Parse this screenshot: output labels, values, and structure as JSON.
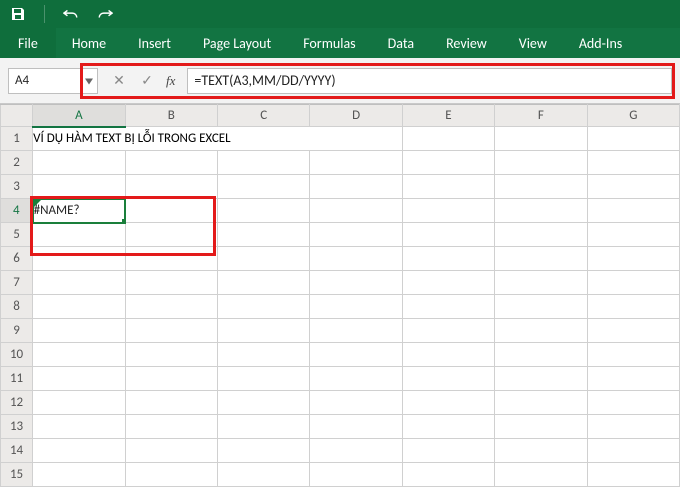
{
  "qat": {
    "save_icon": "save",
    "undo_icon": "undo",
    "redo_icon": "redo"
  },
  "ribbon": {
    "file": "File",
    "tabs": [
      "Home",
      "Insert",
      "Page Layout",
      "Formulas",
      "Data",
      "Review",
      "View",
      "Add-Ins"
    ]
  },
  "namebox": {
    "value": "A4"
  },
  "fx": {
    "cancel": "✕",
    "confirm": "✓",
    "label": "fx",
    "formula": "=TEXT(A3,MM/DD/YYYY)"
  },
  "grid": {
    "columns": [
      "A",
      "B",
      "C",
      "D",
      "E",
      "F",
      "G"
    ],
    "rows": 15,
    "merged_title": "VÍ DỤ HÀM TEXT BỊ LỖI TRONG EXCEL",
    "a4_value": "#NAME?",
    "error_mark": "!"
  }
}
